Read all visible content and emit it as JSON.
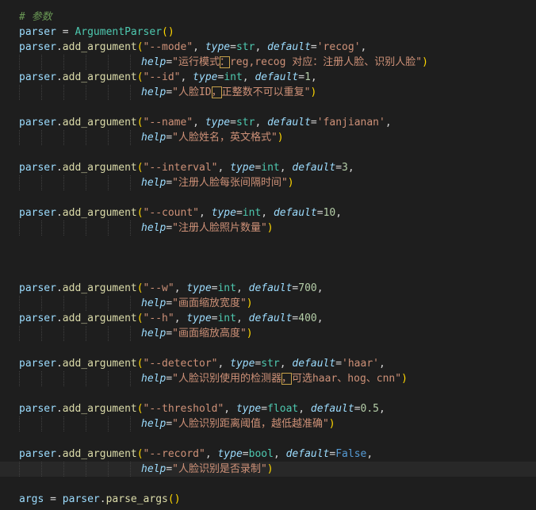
{
  "editor": {
    "theme": {
      "background": "#1e1e1e",
      "current_line": "#282828",
      "comment": "#6a9955",
      "variable": "#9cdcfe",
      "function": "#dcdcaa",
      "class": "#4ec9b0",
      "string": "#ce9178",
      "number": "#b5cea8",
      "keyword": "#569cd6",
      "bracket": "#ffd700"
    },
    "current_line_index": 30,
    "lines": [
      [
        {
          "t": "# 参数",
          "c": "comment"
        }
      ],
      [
        {
          "t": "parser",
          "c": "var"
        },
        {
          "t": " = ",
          "c": "op"
        },
        {
          "t": "ArgumentParser",
          "c": "cls"
        },
        {
          "t": "()",
          "c": "paren"
        }
      ],
      [
        {
          "t": "parser",
          "c": "var"
        },
        {
          "t": ".",
          "c": "punc"
        },
        {
          "t": "add_argument",
          "c": "fn"
        },
        {
          "t": "(",
          "c": "paren"
        },
        {
          "t": "\"--mode\"",
          "c": "str"
        },
        {
          "t": ", ",
          "c": "punc"
        },
        {
          "t": "type",
          "c": "param"
        },
        {
          "t": "=",
          "c": "op"
        },
        {
          "t": "str",
          "c": "cls"
        },
        {
          "t": ", ",
          "c": "punc"
        },
        {
          "t": "default",
          "c": "param"
        },
        {
          "t": "=",
          "c": "op"
        },
        {
          "t": "'recog'",
          "c": "str"
        },
        {
          "t": ",",
          "c": "punc"
        }
      ],
      [
        {
          "t": "help",
          "c": "param"
        },
        {
          "t": "=",
          "c": "op"
        },
        {
          "t": "\"运行模式",
          "c": "str"
        },
        {
          "t": "：",
          "c": "str",
          "w": true
        },
        {
          "t": "reg,recog 对应：注册人脸、识别人脸\"",
          "c": "str"
        },
        {
          "t": ")",
          "c": "paren"
        }
      ],
      [
        {
          "t": "parser",
          "c": "var"
        },
        {
          "t": ".",
          "c": "punc"
        },
        {
          "t": "add_argument",
          "c": "fn"
        },
        {
          "t": "(",
          "c": "paren"
        },
        {
          "t": "\"--id\"",
          "c": "str"
        },
        {
          "t": ", ",
          "c": "punc"
        },
        {
          "t": "type",
          "c": "param"
        },
        {
          "t": "=",
          "c": "op"
        },
        {
          "t": "int",
          "c": "cls"
        },
        {
          "t": ", ",
          "c": "punc"
        },
        {
          "t": "default",
          "c": "param"
        },
        {
          "t": "=",
          "c": "op"
        },
        {
          "t": "1",
          "c": "num"
        },
        {
          "t": ",",
          "c": "punc"
        }
      ],
      [
        {
          "t": "help",
          "c": "param"
        },
        {
          "t": "=",
          "c": "op"
        },
        {
          "t": "\"人脸ID",
          "c": "str"
        },
        {
          "t": "，",
          "c": "str",
          "w": true
        },
        {
          "t": "正整数不可以重复\"",
          "c": "str"
        },
        {
          "t": ")",
          "c": "paren"
        }
      ],
      [],
      [
        {
          "t": "parser",
          "c": "var"
        },
        {
          "t": ".",
          "c": "punc"
        },
        {
          "t": "add_argument",
          "c": "fn"
        },
        {
          "t": "(",
          "c": "paren"
        },
        {
          "t": "\"--name\"",
          "c": "str"
        },
        {
          "t": ", ",
          "c": "punc"
        },
        {
          "t": "type",
          "c": "param"
        },
        {
          "t": "=",
          "c": "op"
        },
        {
          "t": "str",
          "c": "cls"
        },
        {
          "t": ", ",
          "c": "punc"
        },
        {
          "t": "default",
          "c": "param"
        },
        {
          "t": "=",
          "c": "op"
        },
        {
          "t": "'fanjianan'",
          "c": "str"
        },
        {
          "t": ",",
          "c": "punc"
        }
      ],
      [
        {
          "t": "help",
          "c": "param"
        },
        {
          "t": "=",
          "c": "op"
        },
        {
          "t": "\"人脸姓名，英文格式\"",
          "c": "str"
        },
        {
          "t": ")",
          "c": "paren"
        }
      ],
      [],
      [
        {
          "t": "parser",
          "c": "var"
        },
        {
          "t": ".",
          "c": "punc"
        },
        {
          "t": "add_argument",
          "c": "fn"
        },
        {
          "t": "(",
          "c": "paren"
        },
        {
          "t": "\"--interval\"",
          "c": "str"
        },
        {
          "t": ", ",
          "c": "punc"
        },
        {
          "t": "type",
          "c": "param"
        },
        {
          "t": "=",
          "c": "op"
        },
        {
          "t": "int",
          "c": "cls"
        },
        {
          "t": ", ",
          "c": "punc"
        },
        {
          "t": "default",
          "c": "param"
        },
        {
          "t": "=",
          "c": "op"
        },
        {
          "t": "3",
          "c": "num"
        },
        {
          "t": ",",
          "c": "punc"
        }
      ],
      [
        {
          "t": "help",
          "c": "param"
        },
        {
          "t": "=",
          "c": "op"
        },
        {
          "t": "\"注册人脸每张间隔时间\"",
          "c": "str"
        },
        {
          "t": ")",
          "c": "paren"
        }
      ],
      [],
      [
        {
          "t": "parser",
          "c": "var"
        },
        {
          "t": ".",
          "c": "punc"
        },
        {
          "t": "add_argument",
          "c": "fn"
        },
        {
          "t": "(",
          "c": "paren"
        },
        {
          "t": "\"--count\"",
          "c": "str"
        },
        {
          "t": ", ",
          "c": "punc"
        },
        {
          "t": "type",
          "c": "param"
        },
        {
          "t": "=",
          "c": "op"
        },
        {
          "t": "int",
          "c": "cls"
        },
        {
          "t": ", ",
          "c": "punc"
        },
        {
          "t": "default",
          "c": "param"
        },
        {
          "t": "=",
          "c": "op"
        },
        {
          "t": "10",
          "c": "num"
        },
        {
          "t": ",",
          "c": "punc"
        }
      ],
      [
        {
          "t": "help",
          "c": "param"
        },
        {
          "t": "=",
          "c": "op"
        },
        {
          "t": "\"注册人脸照片数量\"",
          "c": "str"
        },
        {
          "t": ")",
          "c": "paren"
        }
      ],
      [],
      [],
      [],
      [
        {
          "t": "parser",
          "c": "var"
        },
        {
          "t": ".",
          "c": "punc"
        },
        {
          "t": "add_argument",
          "c": "fn"
        },
        {
          "t": "(",
          "c": "paren"
        },
        {
          "t": "\"--w\"",
          "c": "str"
        },
        {
          "t": ", ",
          "c": "punc"
        },
        {
          "t": "type",
          "c": "param"
        },
        {
          "t": "=",
          "c": "op"
        },
        {
          "t": "int",
          "c": "cls"
        },
        {
          "t": ", ",
          "c": "punc"
        },
        {
          "t": "default",
          "c": "param"
        },
        {
          "t": "=",
          "c": "op"
        },
        {
          "t": "700",
          "c": "num"
        },
        {
          "t": ",",
          "c": "punc"
        }
      ],
      [
        {
          "t": "help",
          "c": "param"
        },
        {
          "t": "=",
          "c": "op"
        },
        {
          "t": "\"画面缩放宽度\"",
          "c": "str"
        },
        {
          "t": ")",
          "c": "paren"
        }
      ],
      [
        {
          "t": "parser",
          "c": "var"
        },
        {
          "t": ".",
          "c": "punc"
        },
        {
          "t": "add_argument",
          "c": "fn"
        },
        {
          "t": "(",
          "c": "paren"
        },
        {
          "t": "\"--h\"",
          "c": "str"
        },
        {
          "t": ", ",
          "c": "punc"
        },
        {
          "t": "type",
          "c": "param"
        },
        {
          "t": "=",
          "c": "op"
        },
        {
          "t": "int",
          "c": "cls"
        },
        {
          "t": ", ",
          "c": "punc"
        },
        {
          "t": "default",
          "c": "param"
        },
        {
          "t": "=",
          "c": "op"
        },
        {
          "t": "400",
          "c": "num"
        },
        {
          "t": ",",
          "c": "punc"
        }
      ],
      [
        {
          "t": "help",
          "c": "param"
        },
        {
          "t": "=",
          "c": "op"
        },
        {
          "t": "\"画面缩放高度\"",
          "c": "str"
        },
        {
          "t": ")",
          "c": "paren"
        }
      ],
      [],
      [
        {
          "t": "parser",
          "c": "var"
        },
        {
          "t": ".",
          "c": "punc"
        },
        {
          "t": "add_argument",
          "c": "fn"
        },
        {
          "t": "(",
          "c": "paren"
        },
        {
          "t": "\"--detector\"",
          "c": "str"
        },
        {
          "t": ", ",
          "c": "punc"
        },
        {
          "t": "type",
          "c": "param"
        },
        {
          "t": "=",
          "c": "op"
        },
        {
          "t": "str",
          "c": "cls"
        },
        {
          "t": ", ",
          "c": "punc"
        },
        {
          "t": "default",
          "c": "param"
        },
        {
          "t": "=",
          "c": "op"
        },
        {
          "t": "'haar'",
          "c": "str"
        },
        {
          "t": ",",
          "c": "punc"
        }
      ],
      [
        {
          "t": "help",
          "c": "param"
        },
        {
          "t": "=",
          "c": "op"
        },
        {
          "t": "\"人脸识别使用的检测器",
          "c": "str"
        },
        {
          "t": "，",
          "c": "str",
          "w": true
        },
        {
          "t": "可选haar、hog、cnn\"",
          "c": "str"
        },
        {
          "t": ")",
          "c": "paren"
        }
      ],
      [],
      [
        {
          "t": "parser",
          "c": "var"
        },
        {
          "t": ".",
          "c": "punc"
        },
        {
          "t": "add_argument",
          "c": "fn"
        },
        {
          "t": "(",
          "c": "paren"
        },
        {
          "t": "\"--threshold\"",
          "c": "str"
        },
        {
          "t": ", ",
          "c": "punc"
        },
        {
          "t": "type",
          "c": "param"
        },
        {
          "t": "=",
          "c": "op"
        },
        {
          "t": "float",
          "c": "cls"
        },
        {
          "t": ", ",
          "c": "punc"
        },
        {
          "t": "default",
          "c": "param"
        },
        {
          "t": "=",
          "c": "op"
        },
        {
          "t": "0.5",
          "c": "num"
        },
        {
          "t": ",",
          "c": "punc"
        }
      ],
      [
        {
          "t": "help",
          "c": "param"
        },
        {
          "t": "=",
          "c": "op"
        },
        {
          "t": "\"人脸识别距离阈值，越低越准确\"",
          "c": "str"
        },
        {
          "t": ")",
          "c": "paren"
        }
      ],
      [],
      [
        {
          "t": "parser",
          "c": "var"
        },
        {
          "t": ".",
          "c": "punc"
        },
        {
          "t": "add_argument",
          "c": "fn"
        },
        {
          "t": "(",
          "c": "paren"
        },
        {
          "t": "\"--record\"",
          "c": "str"
        },
        {
          "t": ", ",
          "c": "punc"
        },
        {
          "t": "type",
          "c": "param"
        },
        {
          "t": "=",
          "c": "op"
        },
        {
          "t": "bool",
          "c": "cls"
        },
        {
          "t": ", ",
          "c": "punc"
        },
        {
          "t": "default",
          "c": "param"
        },
        {
          "t": "=",
          "c": "op"
        },
        {
          "t": "False",
          "c": "kw"
        },
        {
          "t": ",",
          "c": "punc"
        }
      ],
      [
        {
          "t": "help",
          "c": "param"
        },
        {
          "t": "=",
          "c": "op"
        },
        {
          "t": "\"人脸识别是否录制\"",
          "c": "str"
        },
        {
          "t": ")",
          "c": "paren"
        }
      ],
      [],
      [
        {
          "t": "args",
          "c": "var"
        },
        {
          "t": " = ",
          "c": "op"
        },
        {
          "t": "parser",
          "c": "var"
        },
        {
          "t": ".",
          "c": "punc"
        },
        {
          "t": "parse_args",
          "c": "fn"
        },
        {
          "t": "()",
          "c": "paren"
        }
      ]
    ]
  }
}
